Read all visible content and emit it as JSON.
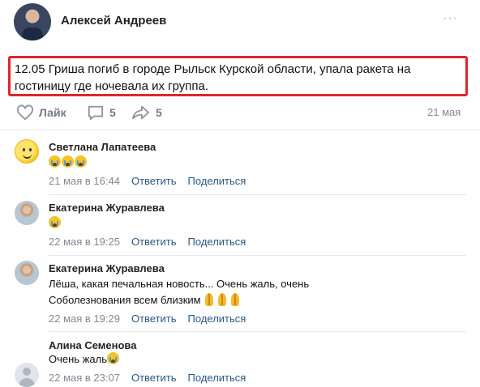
{
  "post": {
    "author": "Алексей Андреев",
    "more_label": "···",
    "text": "12.05 Гриша погиб в городе Рыльск Курской области, упала ракета на гостиницу где ночевала их группа.",
    "actions": {
      "like_label": "Лайк",
      "comments_count": "5",
      "shares_count": "5"
    },
    "date": "21 мая"
  },
  "comments": [
    {
      "name": "Светлана Лапатеева",
      "text": "",
      "emoji": "crying-face x3",
      "date": "21 мая в 16:44",
      "reply": "Ответить",
      "share": "Поделиться"
    },
    {
      "name": "Екатерина Журавлева",
      "text": "",
      "emoji": "crying-face",
      "date": "22 мая в 19:25",
      "reply": "Ответить",
      "share": "Поделиться"
    },
    {
      "name": "Екатерина Журавлева",
      "text_line1": "Лёша, какая печальная новость... Очень жаль, очень",
      "text_line2": "Соболезнования всем близким",
      "emoji": "praying-hands x3",
      "date": "22 мая в 19:29",
      "reply": "Ответить",
      "share": "Поделиться"
    },
    {
      "name": "Алина Семенова",
      "text": "Очень жаль",
      "emoji": "crying-face",
      "date": "22 мая в 23:07",
      "reply": "Ответить",
      "share": "Поделиться"
    }
  ],
  "colors": {
    "highlight_border": "#e0252b",
    "link": "#2a5885",
    "meta": "#828a94"
  }
}
